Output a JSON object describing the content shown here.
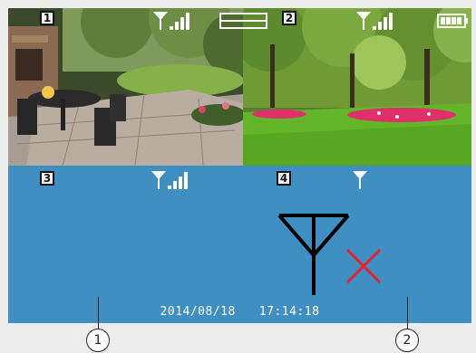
{
  "cameras": [
    {
      "number": "1",
      "signal": "full-signal-icon"
    },
    {
      "number": "2",
      "signal": "full-signal-icon"
    },
    {
      "number": "3",
      "signal": "full-signal-icon"
    },
    {
      "number": "4",
      "signal": "no-signal-icon"
    }
  ],
  "status_bar": {
    "layout_icon": "quad-split-icon",
    "battery_icon": "battery-full-icon"
  },
  "no_signal_indicator": {
    "icon": "antenna-no-signal-icon",
    "cross_color": "#e8202a"
  },
  "footer": {
    "date": "2014/08/18",
    "time": "17:14:18"
  },
  "callouts": [
    "1",
    "2"
  ],
  "colors": {
    "no_video_background": "#3f8fc3",
    "icon_color": "#ffffff"
  }
}
